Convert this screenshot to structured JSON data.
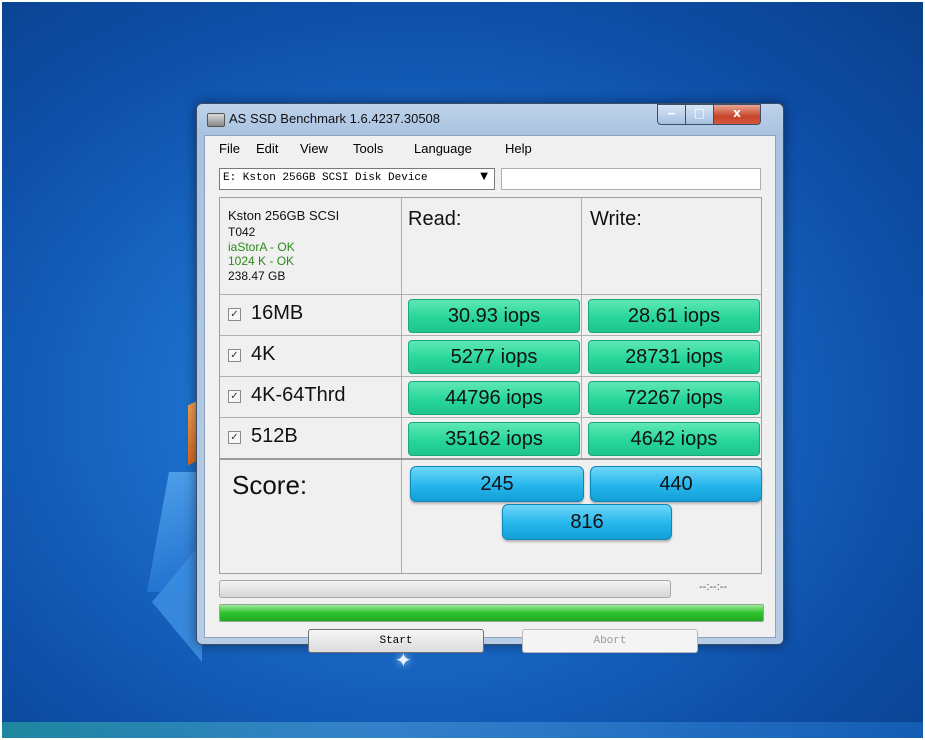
{
  "window": {
    "title": "AS SSD Benchmark 1.6.4237.30508",
    "controls": {
      "minimize": "‒",
      "maximize": "□",
      "close": "x"
    }
  },
  "menu": [
    "File",
    "Edit",
    "View",
    "Tools",
    "Language",
    "Help"
  ],
  "drive": {
    "selected": "E: Kston 256GB SCSI Disk Device",
    "arrow": "▼",
    "side_value": ""
  },
  "info": {
    "name": "Kston 256GB SCSI",
    "firmware": "T042",
    "driver": "iaStorA - OK",
    "alignment": "1024 K - OK",
    "size": "238.47 GB"
  },
  "headers": {
    "read": "Read:",
    "write": "Write:"
  },
  "rows": [
    {
      "label": "16MB",
      "checked": true,
      "read": "30.93 iops",
      "write": "28.61 iops"
    },
    {
      "label": "4K",
      "checked": true,
      "read": "5277 iops",
      "write": "28731 iops"
    },
    {
      "label": "4K-64Thrd",
      "checked": true,
      "read": "44796 iops",
      "write": "72267 iops"
    },
    {
      "label": "512B",
      "checked": true,
      "read": "35162 iops",
      "write": "4642 iops"
    }
  ],
  "checkbox_mark": "✓",
  "score": {
    "label": "Score:",
    "read": "245",
    "write": "440",
    "total": "816"
  },
  "progress": {
    "time": "--:--:--",
    "top_fraction": 0.0,
    "bottom_fraction": 1.0
  },
  "buttons": {
    "start": "Start",
    "abort": "Abort"
  },
  "colors": {
    "result_green": "#28d69a",
    "score_blue": "#25b6ec",
    "progress_green": "#2fc32f"
  }
}
